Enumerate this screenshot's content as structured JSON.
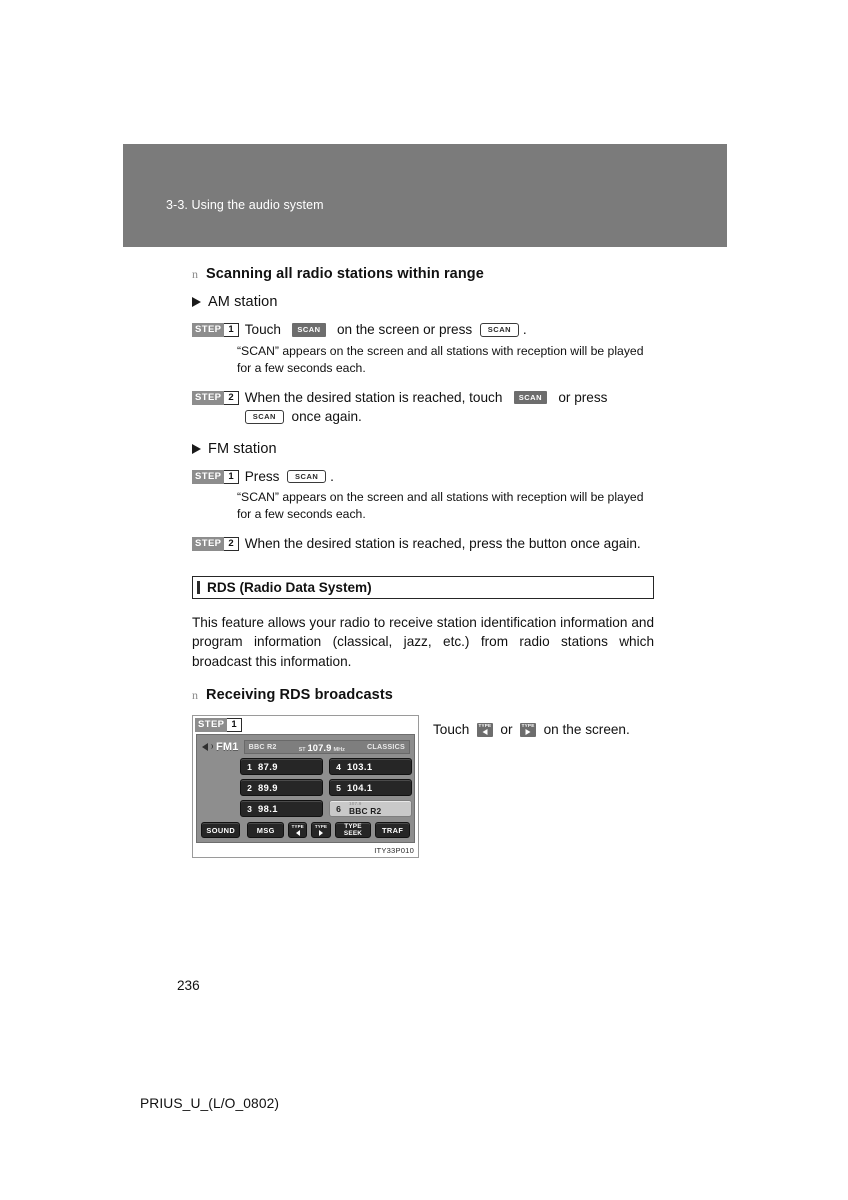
{
  "header": {
    "section_title": "3-3. Using the audio system",
    "band_color": "#7b7b7b"
  },
  "scanning": {
    "heading": "Scanning all radio stations within range",
    "heading_marker": "n",
    "am": {
      "label": "AM station",
      "steps": [
        {
          "badge_word": "STEP",
          "badge_num": "1",
          "text_before": "Touch",
          "touch_button": "SCAN",
          "text_middle": "on the screen or press",
          "hardware_button": "SCAN",
          "text_after": ".",
          "note": "“SCAN” appears on the screen and all stations with reception will be played for a few seconds each."
        },
        {
          "badge_word": "STEP",
          "badge_num": "2",
          "text_before": "When the desired station is reached, touch",
          "touch_button": "SCAN",
          "text_middle": "or press",
          "hardware_button": "SCAN",
          "text_after": "once again."
        }
      ]
    },
    "fm": {
      "label": "FM station",
      "steps": [
        {
          "badge_word": "STEP",
          "badge_num": "1",
          "text_before": "Press",
          "hardware_button": "SCAN",
          "text_after": ".",
          "note": "“SCAN” appears on the screen and all stations with reception will be played for a few seconds each."
        },
        {
          "badge_word": "STEP",
          "badge_num": "2",
          "text_before": "When the desired station is reached, press the button once again."
        }
      ]
    }
  },
  "rds": {
    "section_title": "RDS (Radio Data System)",
    "paragraph": "This feature allows your radio to receive station identification information and program information (classical, jazz, etc.) from radio stations which broadcast this information.",
    "sub_heading": "Receiving RDS broadcasts",
    "sub_heading_marker": "n",
    "instruction": {
      "text_before": "Touch",
      "type_prev_label": "TYPE",
      "text_middle": "or",
      "type_next_label": "TYPE",
      "text_after": "on the screen."
    }
  },
  "figure": {
    "badge_word": "STEP",
    "badge_num": "1",
    "caption_code": "ITY33P010",
    "radio": {
      "band": "FM1",
      "station_name": "BBC R2",
      "stereo_indicator": "ST",
      "frequency": "107.9",
      "frequency_unit": "MHz",
      "program_type": "CLASSICS",
      "presets_left": [
        {
          "num": "1",
          "value": "87.9"
        },
        {
          "num": "2",
          "value": "89.9"
        },
        {
          "num": "3",
          "value": "98.1"
        }
      ],
      "presets_right": [
        {
          "num": "4",
          "value": "103.1"
        },
        {
          "num": "5",
          "value": "104.1"
        },
        {
          "num": "6",
          "value": "BBC R2",
          "small_value": "107.9",
          "selected": true
        }
      ],
      "buttons": {
        "sound": "SOUND",
        "msg": "MSG",
        "type_prev": "TYPE",
        "type_next": "TYPE",
        "type_seek_line1": "TYPE",
        "type_seek_line2": "SEEK",
        "traf": "TRAF"
      }
    }
  },
  "footer": {
    "page_number": "236",
    "document_code": "PRIUS_U_(L/O_0802)"
  }
}
